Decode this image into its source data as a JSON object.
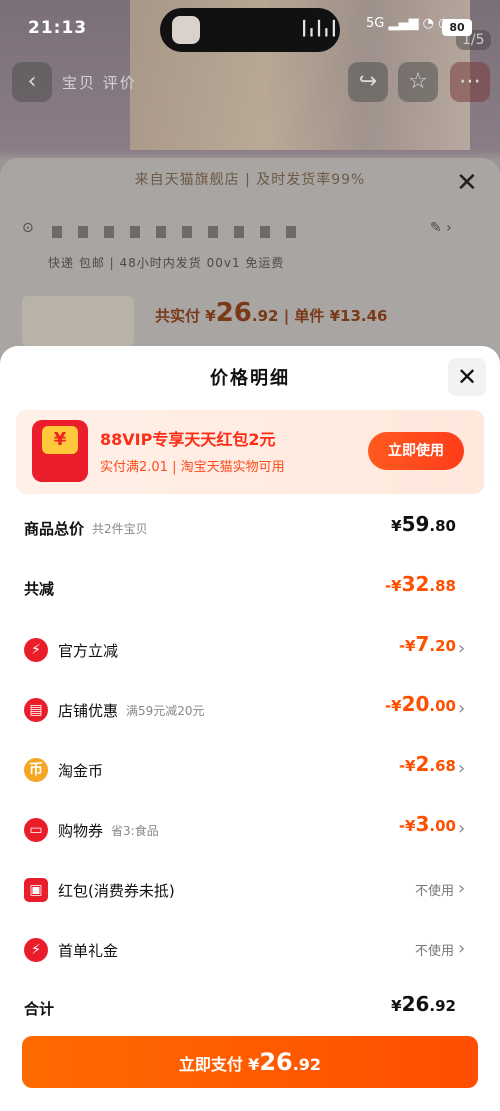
{
  "status_bar": {
    "time": "21:13",
    "network": "5G",
    "battery": "80"
  },
  "background": {
    "page_count": "1/5",
    "nav_text": "宝贝  评价"
  },
  "order_panel": {
    "banner": "来自天猫旗舰店 | 及时发货率99%",
    "delivery": "快递 包邮 | 48小时内发货   00v1 免运费",
    "total_label": "共实付",
    "total_currency": "¥",
    "total_int": "26",
    "total_dec": ".92",
    "unit_label": "| 单件 ¥13.46"
  },
  "sheet": {
    "title": "价格明细",
    "promo": {
      "title": "88VIP专享天天红包2元",
      "subtitle": "实付满2.01 | 淘宝天猫实物可用",
      "button": "立即使用",
      "icon_glyph": "¥"
    },
    "rows": {
      "goods_total": {
        "label": "商品总价",
        "note": "共2件宝贝",
        "cur": "¥",
        "int": "59",
        "dec": ".80"
      },
      "total_discount": {
        "label": "共减",
        "cur": "-¥",
        "int": "32",
        "dec": ".88"
      },
      "official": {
        "label": "官方立减",
        "cur": "-¥",
        "int": "7",
        "dec": ".20"
      },
      "store": {
        "label": "店铺优惠",
        "note": "满59元减20元",
        "cur": "-¥",
        "int": "20",
        "dec": ".00"
      },
      "coins": {
        "label": "淘金币",
        "cur": "-¥",
        "int": "2",
        "dec": ".68"
      },
      "voucher": {
        "label": "购物券",
        "note": "省3:食品",
        "cur": "-¥",
        "int": "3",
        "dec": ".00"
      },
      "redpacket": {
        "label": "红包(消费券未抵)",
        "value": "不使用"
      },
      "firstgift": {
        "label": "首单礼金",
        "value": "不使用"
      },
      "sum": {
        "label": "合计",
        "cur": "¥",
        "int": "26",
        "dec": ".92"
      }
    },
    "pay_button": {
      "label": "立即支付",
      "cur": "¥",
      "int": "26",
      "dec": ".92"
    }
  },
  "colors": {
    "accent": "#ff5000",
    "red": "#ea1e2a",
    "coin": "#f5a623"
  }
}
